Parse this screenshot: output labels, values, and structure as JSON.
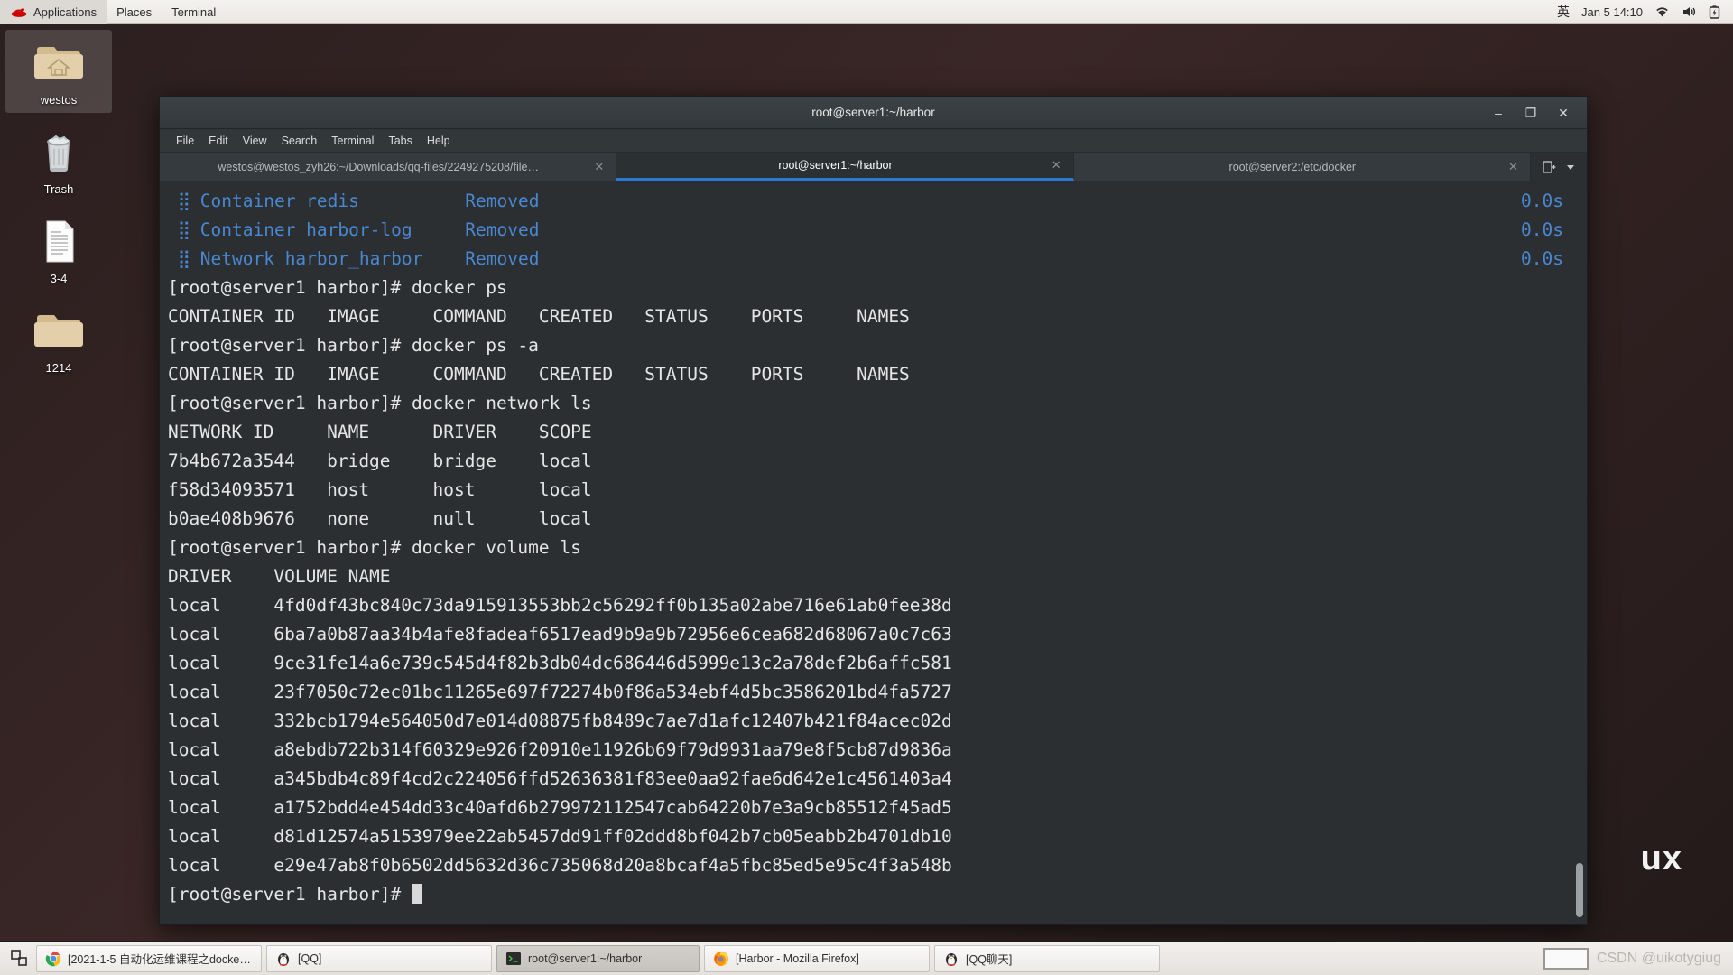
{
  "top_panel": {
    "logo_icon": "redhat-logo-icon",
    "menus": [
      "Applications",
      "Places",
      "Terminal"
    ],
    "ime": "英",
    "clock": "Jan 5  14:10",
    "tray_icons": [
      "wifi-icon",
      "volume-icon",
      "battery-icon"
    ]
  },
  "desktop": {
    "wallpaper_text": "ux",
    "icons": [
      {
        "label": "westos",
        "icon": "home-folder-icon",
        "selected": true
      },
      {
        "label": "Trash",
        "icon": "trash-icon",
        "selected": false
      },
      {
        "label": "3-4",
        "icon": "document-icon",
        "selected": false
      },
      {
        "label": "1214",
        "icon": "folder-icon",
        "selected": false
      }
    ]
  },
  "terminal_window": {
    "title": "root@server1:~/harbor",
    "controls": {
      "minimize": "–",
      "maximize": "❐",
      "close": "✕"
    },
    "menus": [
      "File",
      "Edit",
      "View",
      "Search",
      "Terminal",
      "Tabs",
      "Help"
    ],
    "tabs": [
      {
        "label": "westos@westos_zyh26:~/Downloads/qq-files/2249275208/file…",
        "active": false,
        "close": "✕"
      },
      {
        "label": "root@server1:~/harbor",
        "active": true,
        "close": "✕"
      },
      {
        "label": "root@server2:/etc/docker",
        "active": false,
        "close": "✕"
      }
    ],
    "tab_actions": {
      "new_tab_icon": "new-tab-icon",
      "dropdown_icon": "chevron-down-icon"
    },
    "colors": {
      "background": "#2b2f31",
      "foreground": "#e6e6e6",
      "accent_blue": "#4a87d1",
      "tab_active_underline": "#2779d4"
    },
    "content": {
      "compose_lines": [
        {
          "dots": "⣿",
          "text": " Container redis          ",
          "status": "Removed",
          "time": "0.0s"
        },
        {
          "dots": "⣿",
          "text": " Container harbor-log     ",
          "status": "Removed",
          "time": "0.0s"
        },
        {
          "dots": "⣿",
          "text": " Network harbor_harbor    ",
          "status": "Removed",
          "time": "0.0s"
        }
      ],
      "lines": [
        "[root@server1 harbor]# docker ps",
        "CONTAINER ID   IMAGE     COMMAND   CREATED   STATUS    PORTS     NAMES",
        "[root@server1 harbor]# docker ps -a",
        "CONTAINER ID   IMAGE     COMMAND   CREATED   STATUS    PORTS     NAMES",
        "[root@server1 harbor]# docker network ls",
        "NETWORK ID     NAME      DRIVER    SCOPE",
        "7b4b672a3544   bridge    bridge    local",
        "f58d34093571   host      host      local",
        "b0ae408b9676   none      null      local",
        "[root@server1 harbor]# docker volume ls",
        "DRIVER    VOLUME NAME",
        "local     4fd0df43bc840c73da915913553bb2c56292ff0b135a02abe716e61ab0fee38d",
        "local     6ba7a0b87aa34b4afe8fadeaf6517ead9b9a9b72956e6cea682d68067a0c7c63",
        "local     9ce31fe14a6e739c545d4f82b3db04dc686446d5999e13c2a78def2b6affc581",
        "local     23f7050c72ec01bc11265e697f72274b0f86a534ebf4d5bc3586201bd4fa5727",
        "local     332bcb1794e564050d7e014d08875fb8489c7ae7d1afc12407b421f84acec02d",
        "local     a8ebdb722b314f60329e926f20910e11926b69f79d9931aa79e8f5cb87d9836a",
        "local     a345bdb4c89f4cd2c224056ffd52636381f83ee0aa92fae6d642e1c4561403a4",
        "local     a1752bdd4e454dd33c40afd6b279972112547cab64220b7e3a9cb85512f45ad5",
        "local     d81d12574a5153979ee22ab5457dd91ff02ddd8bf042b7cb05eabb2b4701db10",
        "local     e29e47ab8f0b6502dd5632d36c735068d20a8bcaf4a5fbc85ed5e95c4f3a548b"
      ],
      "prompt": "[root@server1 harbor]# "
    }
  },
  "taskbar": {
    "show_desktop_icon": "show-desktop-icon",
    "windows": [
      {
        "label": "[2021-1-5 自动化运维课程之docker…",
        "icon": "chrome-icon",
        "active": false
      },
      {
        "label": "[QQ]",
        "icon": "qq-penguin-icon",
        "active": false
      },
      {
        "label": "root@server1:~/harbor",
        "icon": "terminal-icon",
        "active": true
      },
      {
        "label": "[Harbor - Mozilla Firefox]",
        "icon": "firefox-icon",
        "active": false
      },
      {
        "label": "[QQ聊天]",
        "icon": "qq-penguin-icon",
        "active": false
      }
    ],
    "watermark": "CSDN @uikotygiug"
  }
}
